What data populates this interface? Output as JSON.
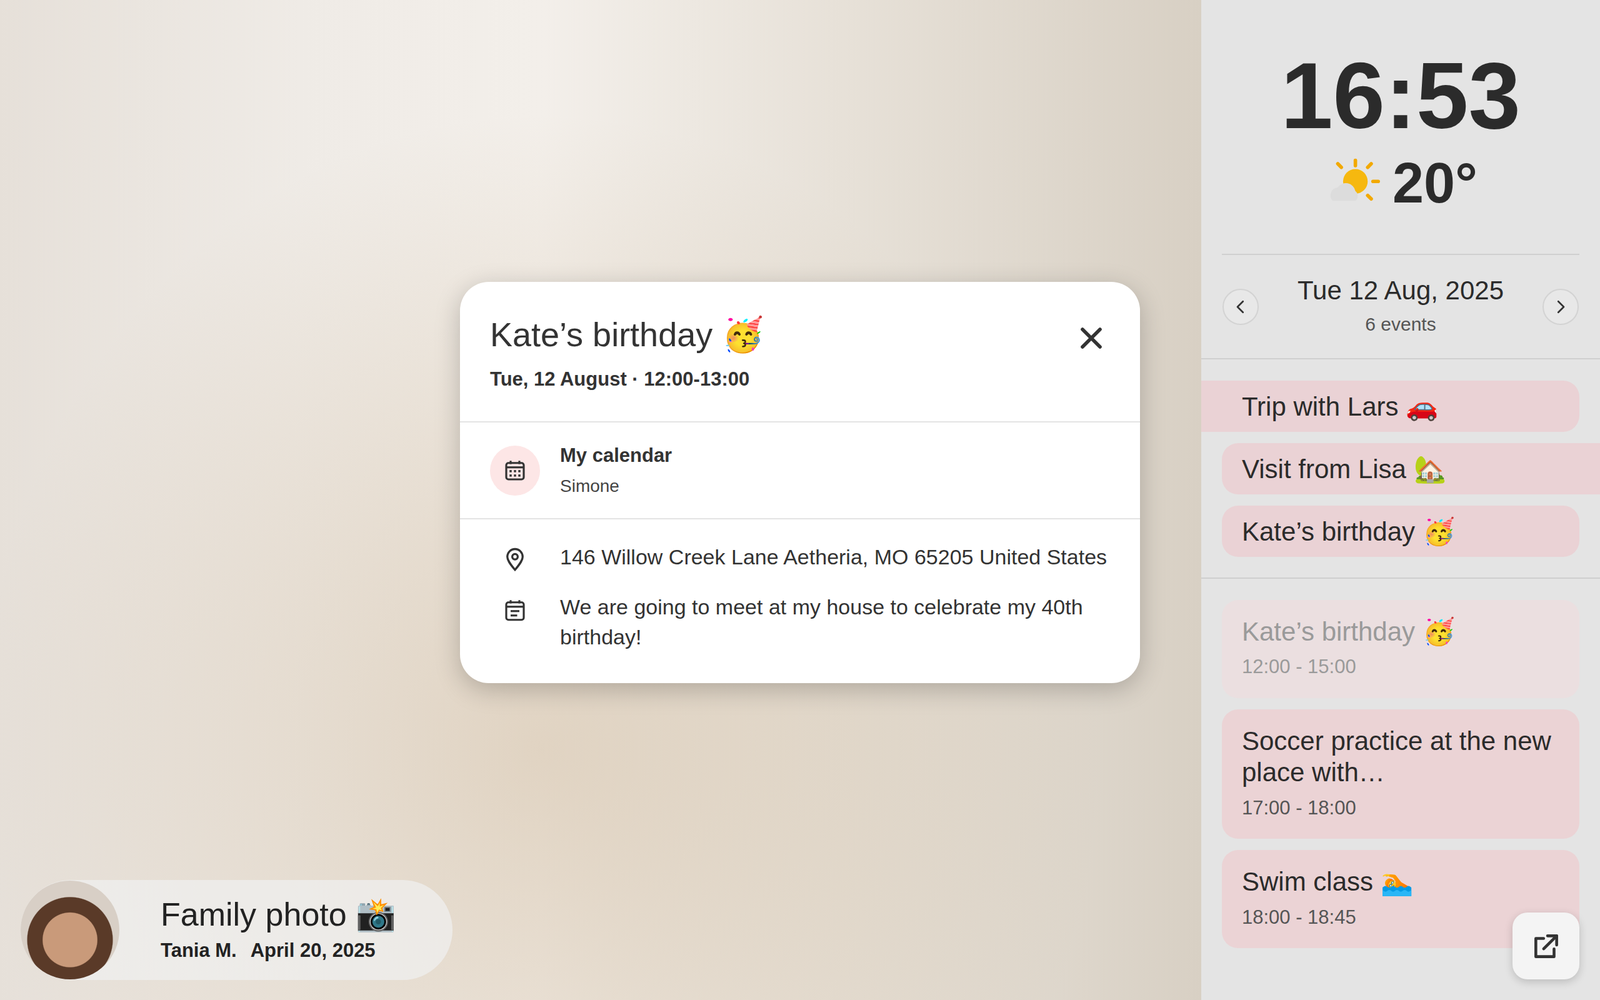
{
  "clock": {
    "time": "16:53",
    "temperature": "20°"
  },
  "day": {
    "date": "Tue 12 Aug, 2025",
    "count": "6 events"
  },
  "all_day_events": [
    {
      "title": "Trip with Lars 🚗",
      "kind": "from-earlier"
    },
    {
      "title": "Visit from Lisa 🏡",
      "kind": "to-later"
    },
    {
      "title": "Kate’s birthday 🥳",
      "kind": "single"
    }
  ],
  "events": [
    {
      "title": "Kate’s birthday 🥳",
      "time": "12:00 - 15:00",
      "past": true
    },
    {
      "title": "Soccer practice at the new place with…",
      "time": "17:00 - 18:00",
      "past": false
    },
    {
      "title": "Swim class 🏊",
      "time": "18:00 - 18:45",
      "past": false
    }
  ],
  "popup": {
    "title": "Kate’s birthday 🥳",
    "when": "Tue, 12 August · 12:00-13:00",
    "calendar": "My calendar",
    "owner": "Simone",
    "location": "146 Willow Creek Lane Aetheria, MO 65205 United States",
    "description": "We are going to meet at my house to celebrate my 40th birthday!"
  },
  "photo": {
    "title": "Family photo 📸",
    "author": "Tania M.",
    "date": "April 20, 2025"
  }
}
